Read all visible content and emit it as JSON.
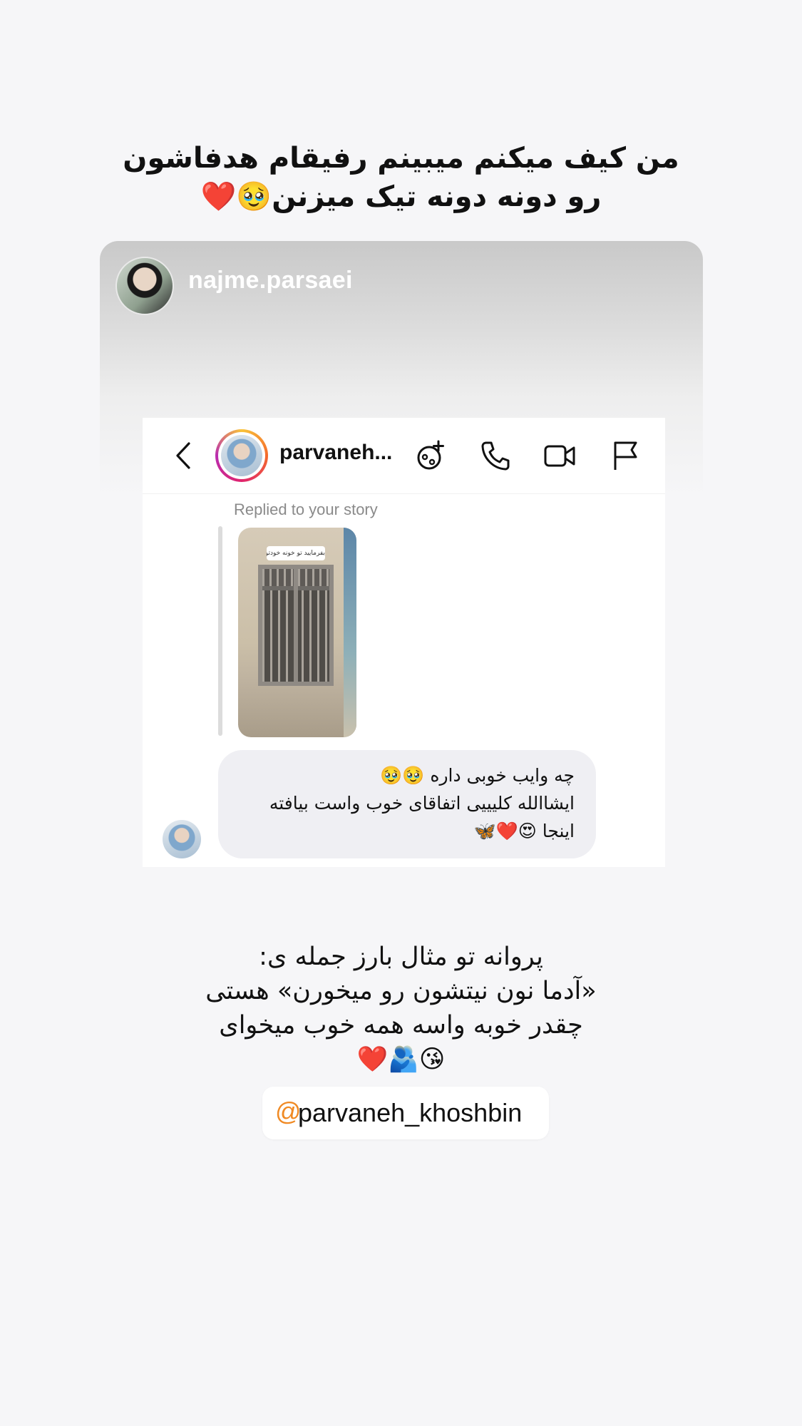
{
  "headline": {
    "line1": "من کیف میکنم میبینم رفیقام هدفاشون",
    "line2": "رو دونه دونه تیک میزنن🥹❤️"
  },
  "story_card": {
    "username": "najme.parsaei"
  },
  "dm_screenshot": {
    "contact_name": "parvaneh...",
    "replied_label": "Replied to your story",
    "story_sticker_text": "بفرمایید تو خونه خودتون😍",
    "message": {
      "line1": "چه وایب خوبی داره 🥹🥹",
      "line2": "ایشاالله کلیییی اتفاقای خوب واست بیافته",
      "line3": "اینجا 😍❤️🦋"
    },
    "icons": [
      "back-icon",
      "add-effect-icon",
      "phone-icon",
      "video-icon",
      "flag-icon"
    ]
  },
  "caption": {
    "line1": "پروانه تو مثال بارز جمله ی:",
    "line2": "«آدما نون نیتشون رو میخورن» هستی",
    "line3": "چقدر خوبه واسه همه خوب میخوای",
    "line4": "😘🫂❤️"
  },
  "mention": {
    "at_symbol": "@",
    "handle": "parvaneh_khoshbin"
  },
  "colors": {
    "background": "#f6f6f8",
    "bubble": "#efeff3",
    "mention_accent": "#f08a24"
  }
}
